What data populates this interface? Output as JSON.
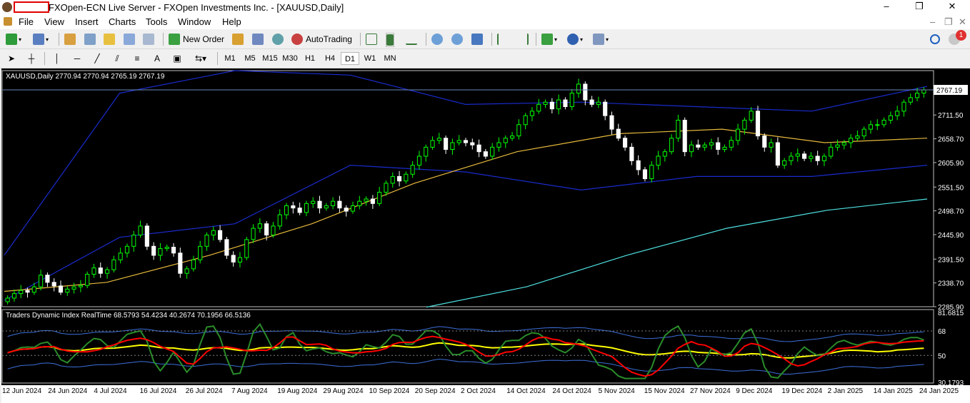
{
  "window": {
    "title": "FXOpen-ECN Live Server - FXOpen Investments Inc. - [XAUUSD,Daily]",
    "controls": [
      "–",
      "❐",
      "✕"
    ]
  },
  "menu": {
    "items": [
      "File",
      "View",
      "Insert",
      "Charts",
      "Tools",
      "Window",
      "Help"
    ],
    "doc_controls": [
      "–",
      "❐",
      "✕"
    ]
  },
  "toolbar": {
    "new_order_label": "New Order",
    "autotrading_label": "AutoTrading",
    "notification_count": "1"
  },
  "timeframes": {
    "items": [
      "M1",
      "M5",
      "M15",
      "M30",
      "H1",
      "H4",
      "D1",
      "W1",
      "MN"
    ],
    "active": "D1"
  },
  "chart": {
    "symbol_header": "XAUUSD,Daily  2770.94 2770.94 2765.19 2767.19",
    "current_price_label": "2767.19",
    "price_labels": [
      "2711.50",
      "2658.70",
      "2605.90",
      "2551.50",
      "2498.70",
      "2445.90",
      "2391.50",
      "2338.70",
      "2285.90"
    ],
    "price_range": [
      2285.9,
      2810
    ],
    "indicator_header": "Traders Dynamic Index RealTime 68.5793 54.4234 40.2674 70.1956 66.5136",
    "indicator_labels": [
      "81.6815",
      "68",
      "50",
      "30.1793"
    ],
    "indicator_range": [
      30.1793,
      81.6815
    ],
    "date_labels": [
      "12 Jun 2024",
      "24 Jun 2024",
      "4 Jul 2024",
      "16 Jul 2024",
      "26 Jul 2024",
      "7 Aug 2024",
      "19 Aug 2024",
      "29 Aug 2024",
      "10 Sep 2024",
      "20 Sep 2024",
      "2 Oct 2024",
      "14 Oct 2024",
      "24 Oct 2024",
      "5 Nov 2024",
      "15 Nov 2024",
      "27 Nov 2024",
      "9 Dec 2024",
      "19 Dec 2024",
      "2 Jan 2025",
      "14 Jan 2025",
      "24 Jan 2025"
    ],
    "colors": {
      "background": "#000000",
      "bull": "#ffffff",
      "bear": "#00ff00",
      "bollinger": "#1a2bcc",
      "ma_orange": "#e6b93c",
      "ma_cyan": "#4fe0e0",
      "tdi_green": "#2a8c2a",
      "tdi_red": "#ff0000",
      "tdi_yellow": "#ffff00",
      "tdi_blue": "#3d6fd9"
    }
  },
  "chart_data": {
    "type": "candlestick",
    "symbol": "XAUUSD",
    "timeframe": "Daily",
    "ohlc_last": {
      "open": 2770.94,
      "high": 2770.94,
      "low": 2765.19,
      "close": 2767.19
    },
    "closes": [
      2305,
      2315,
      2322,
      2318,
      2330,
      2356,
      2340,
      2332,
      2318,
      2325,
      2330,
      2333,
      2358,
      2372,
      2360,
      2368,
      2390,
      2405,
      2420,
      2445,
      2465,
      2420,
      2400,
      2415,
      2418,
      2405,
      2360,
      2370,
      2390,
      2420,
      2445,
      2455,
      2435,
      2400,
      2385,
      2395,
      2435,
      2460,
      2470,
      2445,
      2465,
      2490,
      2510,
      2505,
      2495,
      2515,
      2520,
      2505,
      2510,
      2520,
      2505,
      2498,
      2510,
      2520,
      2525,
      2515,
      2540,
      2560,
      2575,
      2565,
      2580,
      2600,
      2620,
      2640,
      2655,
      2660,
      2635,
      2650,
      2655,
      2650,
      2645,
      2630,
      2620,
      2640,
      2650,
      2660,
      2665,
      2690,
      2710,
      2720,
      2735,
      2740,
      2725,
      2745,
      2730,
      2760,
      2780,
      2745,
      2735,
      2740,
      2710,
      2680,
      2660,
      2640,
      2610,
      2590,
      2570,
      2600,
      2620,
      2630,
      2660,
      2700,
      2630,
      2645,
      2640,
      2645,
      2650,
      2635,
      2640,
      2655,
      2680,
      2700,
      2720,
      2665,
      2640,
      2650,
      2600,
      2610,
      2620,
      2625,
      2615,
      2620,
      2610,
      2620,
      2640,
      2645,
      2650,
      2660,
      2665,
      2680,
      2690,
      2690,
      2700,
      2710,
      2720,
      2740,
      2750,
      2760,
      2767.19
    ],
    "series": [
      {
        "name": "Bollinger Upper",
        "values": [
          2400,
          2760,
          2810,
          2800,
          2735,
          2740,
          2730,
          2720,
          2775
        ]
      },
      {
        "name": "Bollinger Lower",
        "values": [
          2300,
          2440,
          2470,
          2600,
          2585,
          2545,
          2575,
          2575,
          2600
        ]
      },
      {
        "name": "MA 50",
        "values": [
          2320,
          2340,
          2400,
          2470,
          2560,
          2630,
          2670,
          2680,
          2650,
          2660
        ]
      },
      {
        "name": "MA 200",
        "values": [
          2285,
          2330,
          2400,
          2460,
          2500,
          2525
        ]
      }
    ]
  }
}
